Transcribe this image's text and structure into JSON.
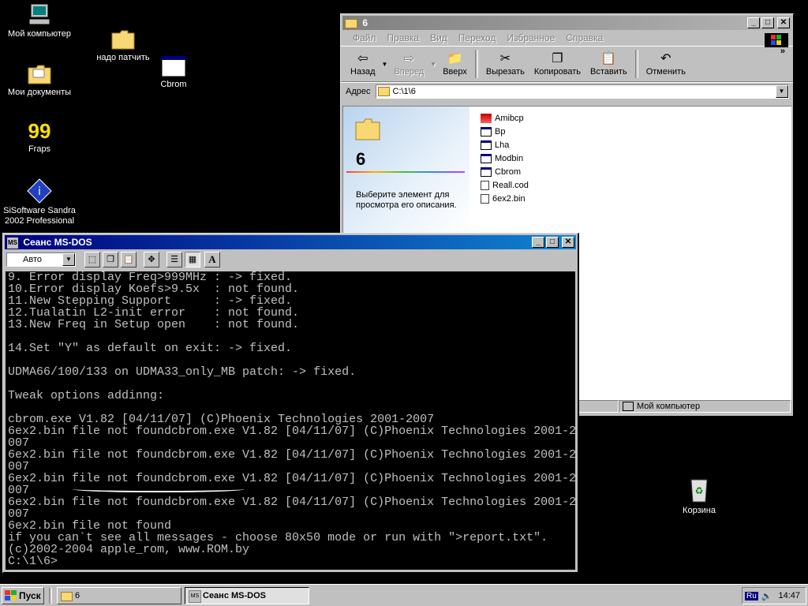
{
  "desktop": {
    "icons": [
      {
        "label": "Мой компьютер"
      },
      {
        "label": "надо патчить"
      },
      {
        "label": "Cbrom"
      },
      {
        "label": "Мои документы"
      },
      {
        "label": "Fraps",
        "glyph": "99"
      },
      {
        "label": "SiSoftware Sandra 2002 Professional"
      },
      {
        "label": "Корзина"
      }
    ]
  },
  "explorer": {
    "title": "6",
    "menu": [
      "Файл",
      "Правка",
      "Вид",
      "Переход",
      "Избранное",
      "Справка"
    ],
    "toolbar": {
      "back": "Назад",
      "forward": "Вперед",
      "up": "Вверх",
      "cut": "Вырезать",
      "copy": "Копировать",
      "paste": "Вставить",
      "undo": "Отменить",
      "more": "»"
    },
    "address_label": "Адрес",
    "address_value": "C:\\1\\6",
    "web_panel": {
      "folder_name": "6",
      "description": "Выберите элемент для просмотра его описания."
    },
    "files": [
      {
        "name": "Amibcp",
        "icon": "amibcp-icon"
      },
      {
        "name": "Bp",
        "icon": "dos-window-icon"
      },
      {
        "name": "Lha",
        "icon": "dos-window-icon"
      },
      {
        "name": "Modbin",
        "icon": "dos-window-icon"
      },
      {
        "name": "Cbrom",
        "icon": "dos-window-icon"
      },
      {
        "name": "Reall.cod",
        "icon": "file-icon"
      },
      {
        "name": "6ex2.bin",
        "icon": "file-icon"
      }
    ],
    "status_computer": "Мой компьютер"
  },
  "dos": {
    "title": "Сеанс MS-DOS",
    "font_value": "Авто",
    "console_lines": [
      "9. Error display Freq>999MHz : -> fixed.",
      "10.Error display Koefs>9.5x  : not found.",
      "11.New Stepping Support      : -> fixed.",
      "12.Tualatin L2-init error    : not found.",
      "13.New Freq in Setup open    : not found.",
      "",
      "14.Set \"Y\" as default on exit: -> fixed.",
      "",
      "UDMA66/100/133 on UDMA33_only_MB patch: -> fixed.",
      "",
      "Tweak options addinng:",
      "",
      "cbrom.exe V1.82 [04/11/07] (C)Phoenix Technologies 2001-2007",
      "6ex2.bin file not foundcbrom.exe V1.82 [04/11/07] (C)Phoenix Technologies 2001-2",
      "007",
      "6ex2.bin file not foundcbrom.exe V1.82 [04/11/07] (C)Phoenix Technologies 2001-2",
      "007",
      "6ex2.bin file not foundcbrom.exe V1.82 [04/11/07] (C)Phoenix Technologies 2001-2",
      "007",
      "6ex2.bin file not foundcbrom.exe V1.82 [04/11/07] (C)Phoenix Technologies 2001-2",
      "007",
      "6ex2.bin file not found",
      "if you can`t see all messages - choose 80x50 mode or run with \">report.txt\".",
      "(c)2002-2004 apple_rom, www.ROM.by",
      "C:\\1\\6>"
    ]
  },
  "taskbar": {
    "start": "Пуск",
    "tasks": [
      "6",
      "Сеанс MS-DOS"
    ],
    "lang": "Ru",
    "clock": "14:47"
  }
}
